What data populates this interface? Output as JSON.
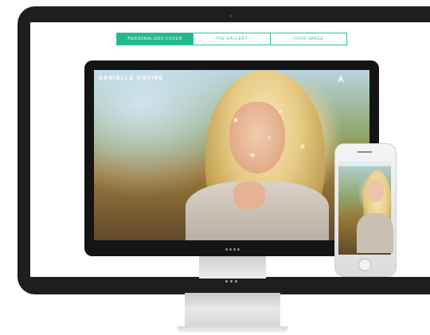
{
  "nav": {
    "tabs": [
      {
        "label": "PERSONALIZED COVER",
        "active": true
      },
      {
        "label": "THE GALLERY",
        "active": false
      },
      {
        "label": "YOUR IMAGE",
        "active": false
      }
    ]
  },
  "hero": {
    "brand_name": "DANIELLE SQUIRE",
    "logo_mark": "A"
  },
  "colors": {
    "accent": "#22b88e",
    "bezel": "#1e1e1e",
    "screen_bg": "#ffffff"
  },
  "icons": {
    "camera": "camera-icon",
    "home_button": "home-button-icon",
    "logo": "logo-icon"
  }
}
